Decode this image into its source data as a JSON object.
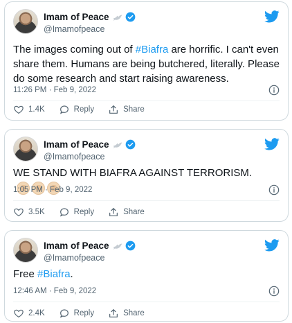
{
  "colors": {
    "accent": "#1d9bf0",
    "text_primary": "#0f1419",
    "text_secondary": "#536471",
    "border": "#cfd9de"
  },
  "tweets": [
    {
      "author_name": "Imam of Peace",
      "handle": "@Imamofpeace",
      "text_before": "The images coming out of ",
      "hashtag": "#Biafra",
      "text_after": " are horrific. I can't even share them. Humans are being butchered, literally. Please do some research and start raising awareness.",
      "emoji": "",
      "timestamp": "11:26 PM · Feb 9, 2022",
      "likes": "1.4K",
      "reply_label": "Reply",
      "share_label": "Share",
      "icons": [
        "dove-icon",
        "verified-icon",
        "twitter-bird-icon",
        "info-icon",
        "heart-icon",
        "reply-icon",
        "share-icon"
      ]
    },
    {
      "author_name": "Imam of Peace",
      "handle": "@Imamofpeace",
      "text_before": "WE STAND WITH BIAFRA AGAINST TERRORISM. ",
      "hashtag": "",
      "text_after": "",
      "emoji": "✊🏼✊🏼✊🏼",
      "timestamp": "1:05 PM · Feb 9, 2022",
      "likes": "3.5K",
      "reply_label": "Reply",
      "share_label": "Share"
    },
    {
      "author_name": "Imam of Peace",
      "handle": "@Imamofpeace",
      "text_before": "Free ",
      "hashtag": "#Biafra",
      "text_after": ".",
      "emoji": "",
      "timestamp": "12:46 AM · Feb 9, 2022",
      "likes": "2.4K",
      "reply_label": "Reply",
      "share_label": "Share"
    }
  ]
}
